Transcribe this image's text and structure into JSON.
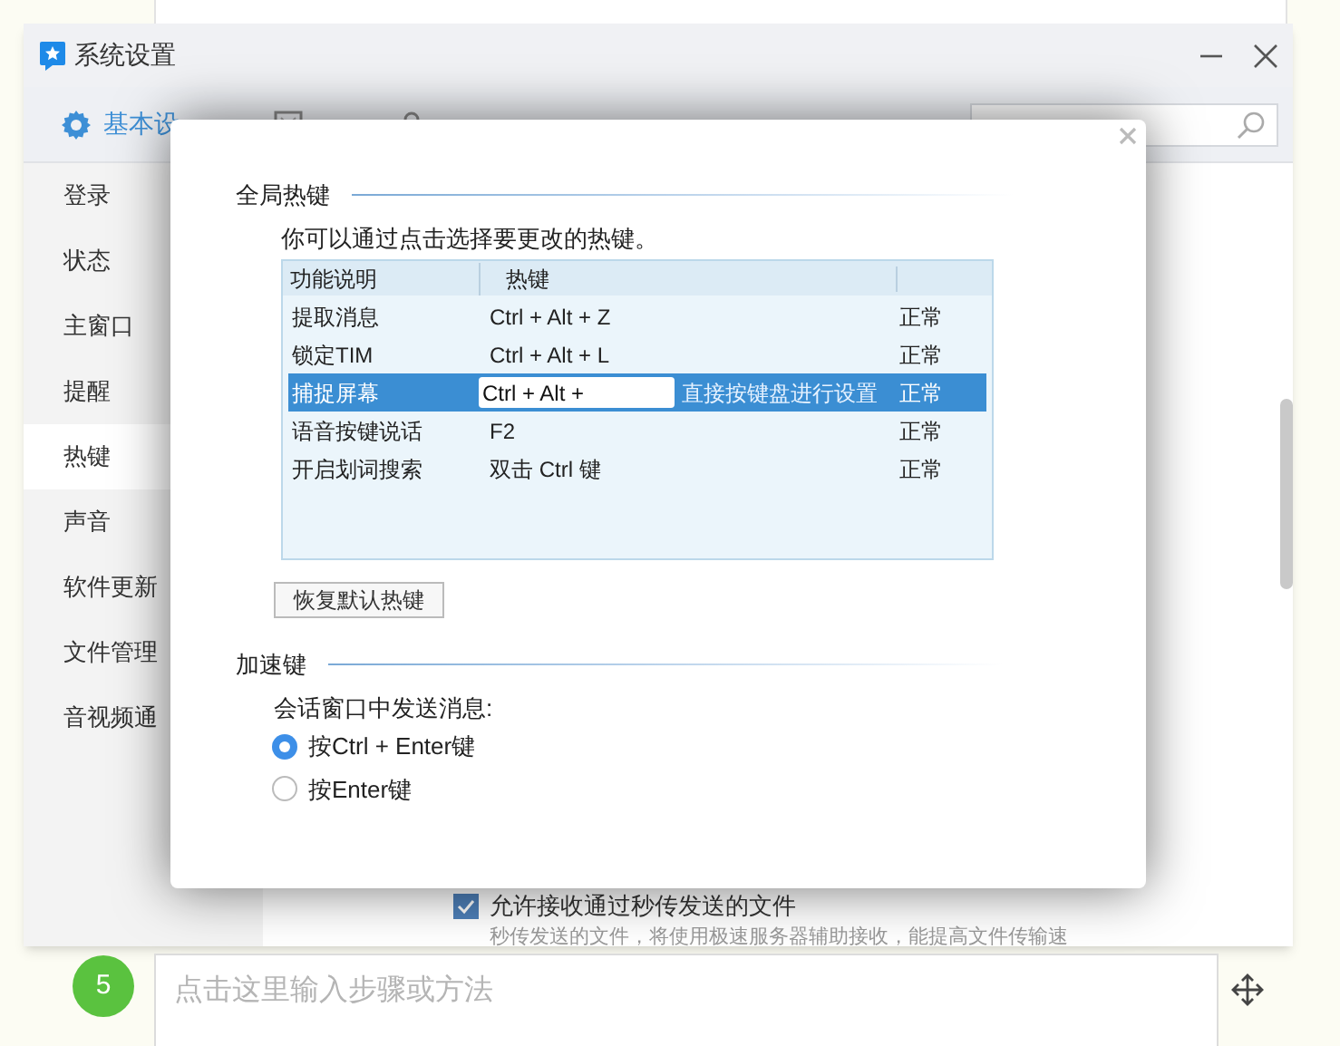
{
  "window": {
    "title": "系统设置"
  },
  "tabs": [
    {
      "label": "基本设",
      "selected": true
    },
    {
      "selected": false
    },
    {
      "selected": false
    }
  ],
  "sidebar": {
    "items": [
      {
        "label": "登录",
        "selected": false
      },
      {
        "label": "状态",
        "selected": false
      },
      {
        "label": "主窗口",
        "selected": false
      },
      {
        "label": "提醒",
        "selected": false
      },
      {
        "label": "热键",
        "selected": true
      },
      {
        "label": "声音",
        "selected": false
      },
      {
        "label": "软件更新",
        "selected": false
      },
      {
        "label": "文件管理",
        "selected": false
      },
      {
        "label": "音视频通",
        "selected": false
      }
    ]
  },
  "content": {
    "checkbox": {
      "label": "允许接收通过秒传发送的文件",
      "checked": true
    },
    "note": "秒传发送的文件，将使用极速服务器辅助接收，能提高文件传输速"
  },
  "dialog": {
    "global_hotkeys": {
      "title": "全局热键",
      "hint": "你可以通过点击选择要更改的热键。",
      "columns": [
        "功能说明",
        "热键"
      ],
      "rows": [
        {
          "function": "提取消息",
          "hotkey": "Ctrl + Alt + Z",
          "status": "正常",
          "selected": false
        },
        {
          "function": "锁定TIM",
          "hotkey": "Ctrl + Alt + L",
          "status": "正常",
          "selected": false
        },
        {
          "function": "捕捉屏幕",
          "hotkey": "Ctrl + Alt +",
          "edit_hint": "直接按键盘进行设置",
          "status": "正常",
          "selected": true
        },
        {
          "function": "语音按键说话",
          "hotkey": "F2",
          "status": "正常",
          "selected": false
        },
        {
          "function": "开启划词搜索",
          "hotkey": "双击 Ctrl 键",
          "status": "正常",
          "selected": false
        }
      ],
      "restore_button": "恢复默认热键"
    },
    "accelerator": {
      "title": "加速键",
      "label": "会话窗口中发送消息:",
      "options": [
        {
          "label": "按Ctrl + Enter键",
          "selected": true
        },
        {
          "label": "按Enter键",
          "selected": false
        }
      ]
    }
  },
  "step": {
    "number": "5",
    "placeholder": "点击这里输入步骤或方法"
  }
}
